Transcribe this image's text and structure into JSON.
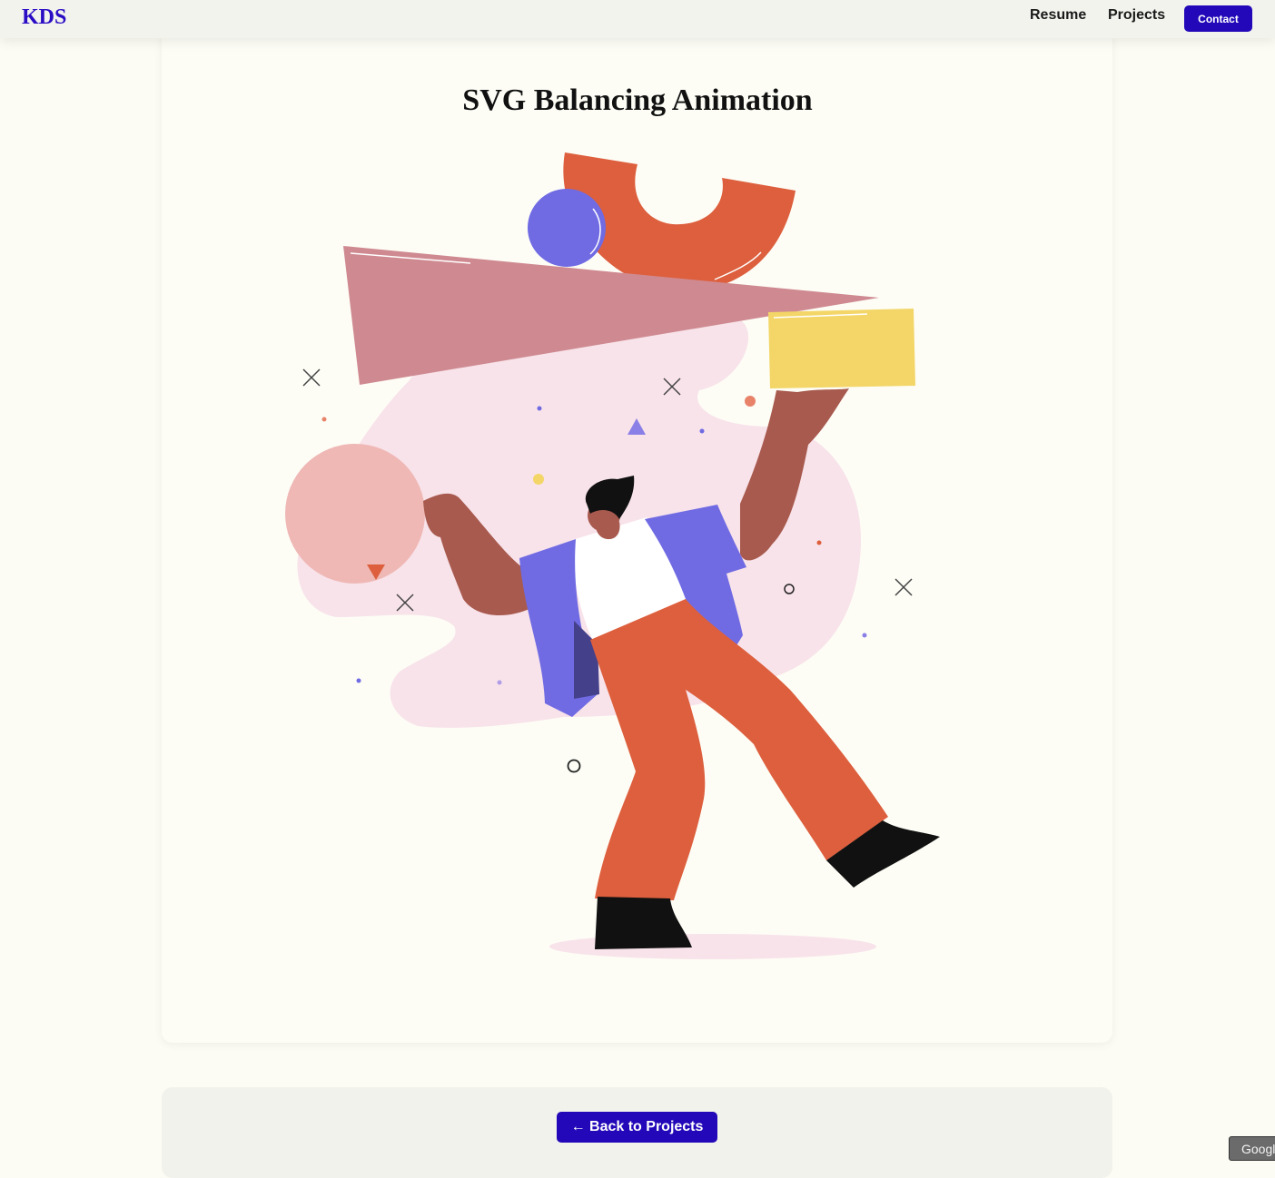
{
  "nav": {
    "logo": "KDS",
    "resume": "Resume",
    "projects": "Projects",
    "contact": "Contact"
  },
  "main": {
    "title": "SVG Balancing Animation"
  },
  "footer": {
    "back_label": "← Back to Projects"
  },
  "badge": {
    "label": "Googl"
  },
  "colors": {
    "accent": "#2208b8",
    "orange": "#dd5f3d",
    "purple": "#706be3",
    "pink_blob": "#f8e3ea",
    "yellow": "#f3d667",
    "triangle": "#cf8a91",
    "skin": "#a85a4e"
  }
}
